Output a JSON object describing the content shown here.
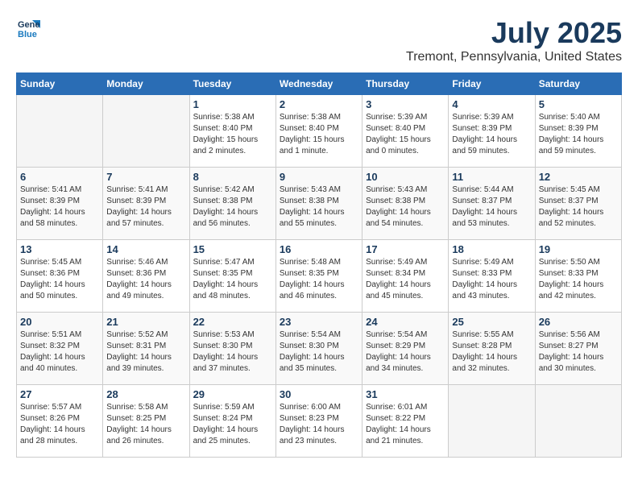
{
  "header": {
    "logo_line1": "General",
    "logo_line2": "Blue",
    "month_title": "July 2025",
    "location": "Tremont, Pennsylvania, United States"
  },
  "weekdays": [
    "Sunday",
    "Monday",
    "Tuesday",
    "Wednesday",
    "Thursday",
    "Friday",
    "Saturday"
  ],
  "weeks": [
    [
      {
        "day": "",
        "info": ""
      },
      {
        "day": "",
        "info": ""
      },
      {
        "day": "1",
        "info": "Sunrise: 5:38 AM\nSunset: 8:40 PM\nDaylight: 15 hours\nand 2 minutes."
      },
      {
        "day": "2",
        "info": "Sunrise: 5:38 AM\nSunset: 8:40 PM\nDaylight: 15 hours\nand 1 minute."
      },
      {
        "day": "3",
        "info": "Sunrise: 5:39 AM\nSunset: 8:40 PM\nDaylight: 15 hours\nand 0 minutes."
      },
      {
        "day": "4",
        "info": "Sunrise: 5:39 AM\nSunset: 8:39 PM\nDaylight: 14 hours\nand 59 minutes."
      },
      {
        "day": "5",
        "info": "Sunrise: 5:40 AM\nSunset: 8:39 PM\nDaylight: 14 hours\nand 59 minutes."
      }
    ],
    [
      {
        "day": "6",
        "info": "Sunrise: 5:41 AM\nSunset: 8:39 PM\nDaylight: 14 hours\nand 58 minutes."
      },
      {
        "day": "7",
        "info": "Sunrise: 5:41 AM\nSunset: 8:39 PM\nDaylight: 14 hours\nand 57 minutes."
      },
      {
        "day": "8",
        "info": "Sunrise: 5:42 AM\nSunset: 8:38 PM\nDaylight: 14 hours\nand 56 minutes."
      },
      {
        "day": "9",
        "info": "Sunrise: 5:43 AM\nSunset: 8:38 PM\nDaylight: 14 hours\nand 55 minutes."
      },
      {
        "day": "10",
        "info": "Sunrise: 5:43 AM\nSunset: 8:38 PM\nDaylight: 14 hours\nand 54 minutes."
      },
      {
        "day": "11",
        "info": "Sunrise: 5:44 AM\nSunset: 8:37 PM\nDaylight: 14 hours\nand 53 minutes."
      },
      {
        "day": "12",
        "info": "Sunrise: 5:45 AM\nSunset: 8:37 PM\nDaylight: 14 hours\nand 52 minutes."
      }
    ],
    [
      {
        "day": "13",
        "info": "Sunrise: 5:45 AM\nSunset: 8:36 PM\nDaylight: 14 hours\nand 50 minutes."
      },
      {
        "day": "14",
        "info": "Sunrise: 5:46 AM\nSunset: 8:36 PM\nDaylight: 14 hours\nand 49 minutes."
      },
      {
        "day": "15",
        "info": "Sunrise: 5:47 AM\nSunset: 8:35 PM\nDaylight: 14 hours\nand 48 minutes."
      },
      {
        "day": "16",
        "info": "Sunrise: 5:48 AM\nSunset: 8:35 PM\nDaylight: 14 hours\nand 46 minutes."
      },
      {
        "day": "17",
        "info": "Sunrise: 5:49 AM\nSunset: 8:34 PM\nDaylight: 14 hours\nand 45 minutes."
      },
      {
        "day": "18",
        "info": "Sunrise: 5:49 AM\nSunset: 8:33 PM\nDaylight: 14 hours\nand 43 minutes."
      },
      {
        "day": "19",
        "info": "Sunrise: 5:50 AM\nSunset: 8:33 PM\nDaylight: 14 hours\nand 42 minutes."
      }
    ],
    [
      {
        "day": "20",
        "info": "Sunrise: 5:51 AM\nSunset: 8:32 PM\nDaylight: 14 hours\nand 40 minutes."
      },
      {
        "day": "21",
        "info": "Sunrise: 5:52 AM\nSunset: 8:31 PM\nDaylight: 14 hours\nand 39 minutes."
      },
      {
        "day": "22",
        "info": "Sunrise: 5:53 AM\nSunset: 8:30 PM\nDaylight: 14 hours\nand 37 minutes."
      },
      {
        "day": "23",
        "info": "Sunrise: 5:54 AM\nSunset: 8:30 PM\nDaylight: 14 hours\nand 35 minutes."
      },
      {
        "day": "24",
        "info": "Sunrise: 5:54 AM\nSunset: 8:29 PM\nDaylight: 14 hours\nand 34 minutes."
      },
      {
        "day": "25",
        "info": "Sunrise: 5:55 AM\nSunset: 8:28 PM\nDaylight: 14 hours\nand 32 minutes."
      },
      {
        "day": "26",
        "info": "Sunrise: 5:56 AM\nSunset: 8:27 PM\nDaylight: 14 hours\nand 30 minutes."
      }
    ],
    [
      {
        "day": "27",
        "info": "Sunrise: 5:57 AM\nSunset: 8:26 PM\nDaylight: 14 hours\nand 28 minutes."
      },
      {
        "day": "28",
        "info": "Sunrise: 5:58 AM\nSunset: 8:25 PM\nDaylight: 14 hours\nand 26 minutes."
      },
      {
        "day": "29",
        "info": "Sunrise: 5:59 AM\nSunset: 8:24 PM\nDaylight: 14 hours\nand 25 minutes."
      },
      {
        "day": "30",
        "info": "Sunrise: 6:00 AM\nSunset: 8:23 PM\nDaylight: 14 hours\nand 23 minutes."
      },
      {
        "day": "31",
        "info": "Sunrise: 6:01 AM\nSunset: 8:22 PM\nDaylight: 14 hours\nand 21 minutes."
      },
      {
        "day": "",
        "info": ""
      },
      {
        "day": "",
        "info": ""
      }
    ]
  ]
}
